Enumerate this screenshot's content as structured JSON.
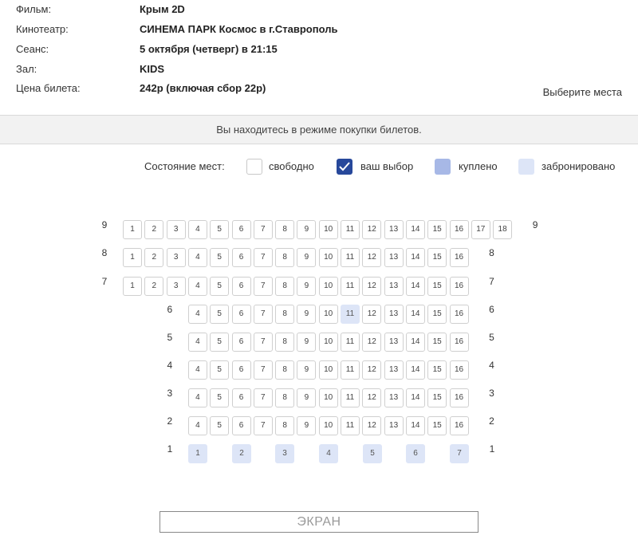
{
  "info": {
    "film_label": "Фильм:",
    "film_value": "Крым 2D",
    "cinema_label": "Кинотеатр:",
    "cinema_value": "СИНЕМА ПАРК Космос в г.Ставрополь",
    "session_label": "Сеанс:",
    "session_value": "5 октября (четверг) в 21:15",
    "hall_label": "Зал:",
    "hall_value": "KIDS",
    "price_label": "Цена билета:",
    "price_value": "242р (включая сбор 22р)",
    "choose_seats": "Выберите места"
  },
  "mode_bar": {
    "text": "Вы находитесь в режиме покупки билетов."
  },
  "legend": {
    "title": "Состояние мест:",
    "free": "свободно",
    "selected": "ваш выбор",
    "bought": "куплено",
    "reserved": "забронировано"
  },
  "rows": [
    {
      "row": "9",
      "seats": [
        "1",
        "2",
        "3",
        "4",
        "5",
        "6",
        "7",
        "8",
        "9",
        "10",
        "11",
        "12",
        "13",
        "14",
        "15",
        "16",
        "17",
        "18"
      ],
      "reserved": []
    },
    {
      "row": "8",
      "seats": [
        "1",
        "2",
        "3",
        "4",
        "5",
        "6",
        "7",
        "8",
        "9",
        "10",
        "11",
        "12",
        "13",
        "14",
        "15",
        "16"
      ],
      "reserved": []
    },
    {
      "row": "7",
      "seats": [
        "1",
        "2",
        "3",
        "4",
        "5",
        "6",
        "7",
        "8",
        "9",
        "10",
        "11",
        "12",
        "13",
        "14",
        "15",
        "16"
      ],
      "reserved": []
    },
    {
      "row": "6",
      "seats": [
        "4",
        "5",
        "6",
        "7",
        "8",
        "9",
        "10",
        "11",
        "12",
        "13",
        "14",
        "15",
        "16"
      ],
      "reserved": [
        "11"
      ]
    },
    {
      "row": "5",
      "seats": [
        "4",
        "5",
        "6",
        "7",
        "8",
        "9",
        "10",
        "11",
        "12",
        "13",
        "14",
        "15",
        "16"
      ],
      "reserved": []
    },
    {
      "row": "4",
      "seats": [
        "4",
        "5",
        "6",
        "7",
        "8",
        "9",
        "10",
        "11",
        "12",
        "13",
        "14",
        "15",
        "16"
      ],
      "reserved": []
    },
    {
      "row": "3",
      "seats": [
        "4",
        "5",
        "6",
        "7",
        "8",
        "9",
        "10",
        "11",
        "12",
        "13",
        "14",
        "15",
        "16"
      ],
      "reserved": []
    },
    {
      "row": "2",
      "seats": [
        "4",
        "5",
        "6",
        "7",
        "8",
        "9",
        "10",
        "11",
        "12",
        "13",
        "14",
        "15",
        "16"
      ],
      "reserved": []
    },
    {
      "row": "1",
      "seats": [
        "1",
        "2",
        "3",
        "4",
        "5",
        "6",
        "7"
      ],
      "reserved": [
        "1",
        "2",
        "3",
        "4",
        "5",
        "6",
        "7"
      ]
    }
  ],
  "screen": {
    "label": "ЭКРАН"
  }
}
